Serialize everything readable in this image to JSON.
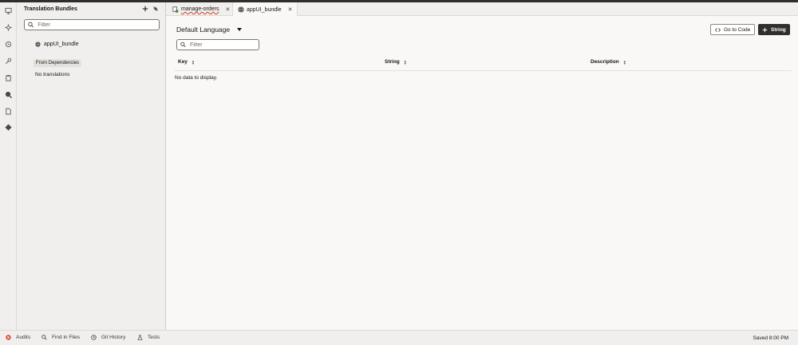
{
  "sidebar": {
    "title": "Translation Bundles",
    "filter_placeholder": "Filter",
    "bundle": "appUI_bundle",
    "section": "From Dependencies",
    "empty": "No translations"
  },
  "tabs": [
    {
      "label": "manage-orders",
      "icon": "page-error-icon"
    },
    {
      "label": "appUI_bundle",
      "icon": "globe-icon"
    }
  ],
  "main": {
    "language": "Default Language",
    "filter_placeholder": "Filter",
    "go_to_code": "Go to Code",
    "add_string": "String",
    "columns": [
      "Key",
      "String",
      "Description"
    ],
    "empty": "No data to display."
  },
  "statusbar": {
    "audits": "Audits",
    "find": "Find in Files",
    "git": "Git History",
    "tests": "Tests",
    "saved": "Saved 8:00 PM"
  },
  "colors": {
    "dark": "#312d2a",
    "error": "#d63b25"
  }
}
